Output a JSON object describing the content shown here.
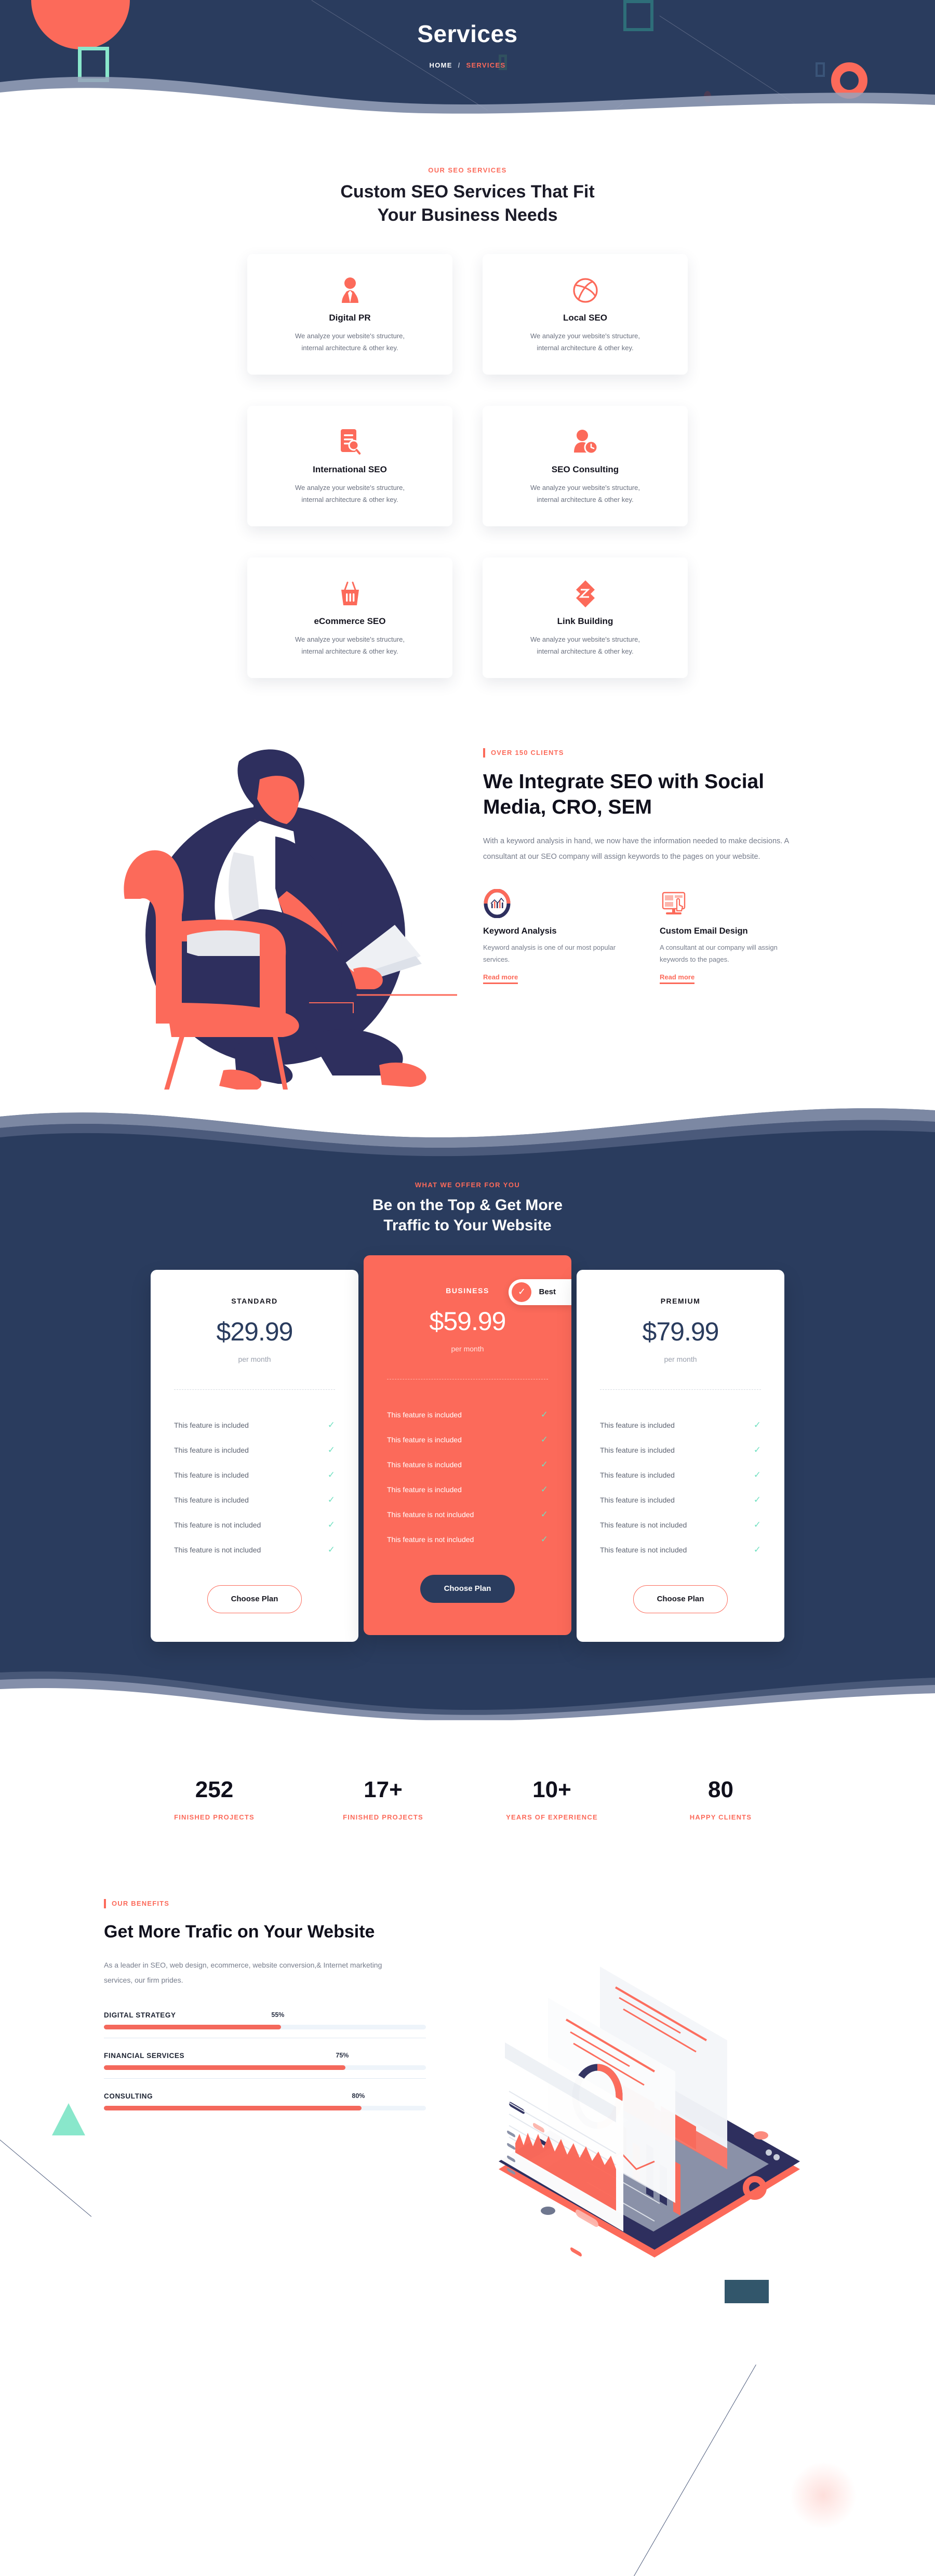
{
  "hero": {
    "title": "Services",
    "breadcrumb": {
      "home": "HOME",
      "separator": "/",
      "current": "SERVICES"
    }
  },
  "services_section": {
    "eyebrow": "OUR SEO SERVICES",
    "title_line1": "Custom SEO Services That Fit",
    "title_line2": "Your Business Needs",
    "cards": [
      {
        "icon": "user-tie-icon",
        "title": "Digital PR",
        "desc_line1": "We analyze your website's structure,",
        "desc_line2": "internal architecture & other key."
      },
      {
        "icon": "dribbble-ball-icon",
        "title": "Local SEO",
        "desc_line1": "We analyze your website's structure,",
        "desc_line2": "internal architecture & other key."
      },
      {
        "icon": "document-search-icon",
        "title": "International SEO",
        "desc_line1": "We analyze your website's structure,",
        "desc_line2": "internal architecture & other key."
      },
      {
        "icon": "user-clock-icon",
        "title": "SEO Consulting",
        "desc_line1": "We analyze your website's structure,",
        "desc_line2": "internal architecture & other key."
      },
      {
        "icon": "shopping-basket-icon",
        "title": "eCommerce SEO",
        "desc_line1": "We analyze your website's structure,",
        "desc_line2": "internal architecture & other key."
      },
      {
        "icon": "link-chain-icon",
        "title": "Link Building",
        "desc_line1": "We analyze your website's structure,",
        "desc_line2": "internal architecture & other key."
      }
    ]
  },
  "integrate": {
    "tagline": "OVER 150 CLIENTS",
    "heading": "We Integrate SEO with Social Media, CRO, SEM",
    "paragraph": "With a keyword analysis in hand, we now have the information needed to make decisions. A consultant at our SEO company will assign keywords to the pages on your website.",
    "features": [
      {
        "icon": "donut-chart-icon",
        "title": "Keyword Analysis",
        "desc": "Keyword analysis is one of our most popular services.",
        "link": "Read more"
      },
      {
        "icon": "monitor-cursor-icon",
        "title": "Custom Email Design",
        "desc": "A consultant at our company will assign keywords to the pages.",
        "link": "Read more"
      }
    ]
  },
  "pricing": {
    "eyebrow": "WHAT WE OFFER FOR YOU",
    "title_line1": "Be on the Top & Get More",
    "title_line2": "Traffic to Your Website",
    "best_badge": "Best",
    "plans": [
      {
        "name": "STANDARD",
        "price": "$29.99",
        "period": "per month",
        "featured": false,
        "button": "Choose Plan",
        "features": [
          "This feature is included",
          "This feature is included",
          "This feature is included",
          "This feature is included",
          "This feature is not included",
          "This feature is not included"
        ]
      },
      {
        "name": "BUSINESS",
        "price": "$59.99",
        "period": "per month",
        "featured": true,
        "button": "Choose Plan",
        "features": [
          "This feature is included",
          "This feature is included",
          "This feature is included",
          "This feature is included",
          "This feature is not included",
          "This feature is not included"
        ]
      },
      {
        "name": "PREMIUM",
        "price": "$79.99",
        "period": "per month",
        "featured": false,
        "button": "Choose Plan",
        "features": [
          "This feature is included",
          "This feature is included",
          "This feature is included",
          "This feature is included",
          "This feature is not included",
          "This feature is not included"
        ]
      }
    ]
  },
  "stats": [
    {
      "value": "252",
      "label": "FINISHED PROJECTS"
    },
    {
      "value": "17+",
      "label": "FINISHED PROJECTS"
    },
    {
      "value": "10+",
      "label": "YEARS OF EXPERIENCE"
    },
    {
      "value": "80",
      "label": "HAPPY CLIENTS"
    }
  ],
  "benefits": {
    "tagline": "OUR BENEFITS",
    "heading": "Get More Trafic on Your Website",
    "paragraph": "As a leader in SEO, web design, ecommerce, website conversion,& Internet marketing services, our firm prides.",
    "bars": [
      {
        "label": "DIGITAL STRATEGY",
        "percent": "55%",
        "value": 55
      },
      {
        "label": "FINANCIAL SERVICES",
        "percent": "75%",
        "value": 75
      },
      {
        "label": "CONSULTING",
        "percent": "80%",
        "value": 80
      }
    ]
  },
  "colors": {
    "navy": "#2a3c5e",
    "coral": "#fc6a5a",
    "mint": "#89e7cb",
    "teal": "#2e6e79",
    "check_green": "#6fe0c0"
  }
}
